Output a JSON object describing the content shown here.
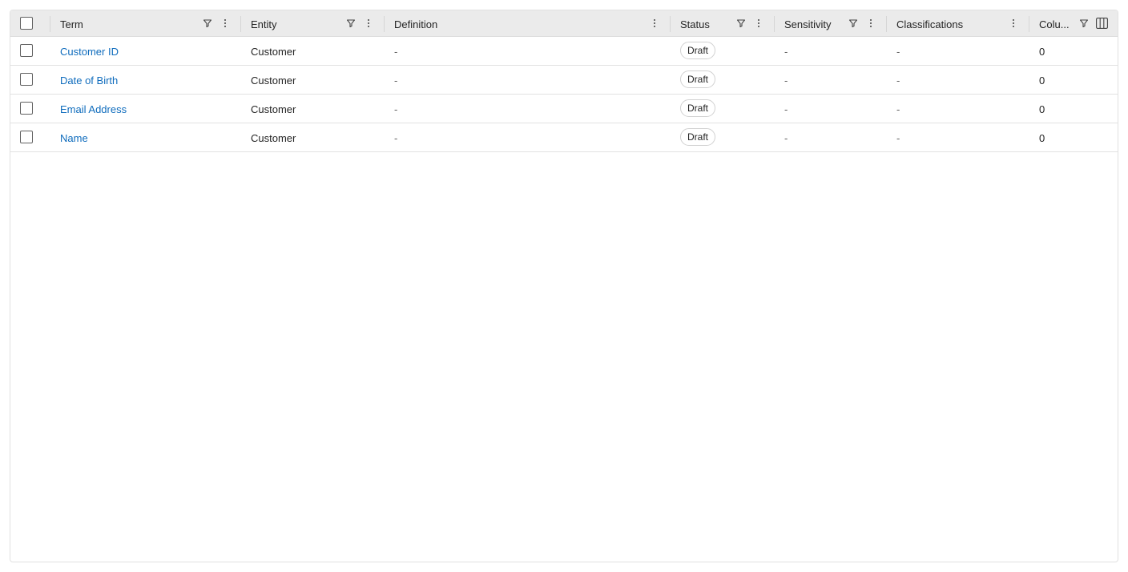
{
  "columns": {
    "term": "Term",
    "entity": "Entity",
    "definition": "Definition",
    "status": "Status",
    "sensitivity": "Sensitivity",
    "classifications": "Classifications",
    "columns_count": "Colu..."
  },
  "rows": [
    {
      "term": "Customer ID",
      "entity": "Customer",
      "definition": "-",
      "status": "Draft",
      "sensitivity": "-",
      "classifications": "-",
      "columns_count": "0"
    },
    {
      "term": "Date of Birth",
      "entity": "Customer",
      "definition": "-",
      "status": "Draft",
      "sensitivity": "-",
      "classifications": "-",
      "columns_count": "0"
    },
    {
      "term": "Email Address",
      "entity": "Customer",
      "definition": "-",
      "status": "Draft",
      "sensitivity": "-",
      "classifications": "-",
      "columns_count": "0"
    },
    {
      "term": "Name",
      "entity": "Customer",
      "definition": "-",
      "status": "Draft",
      "sensitivity": "-",
      "classifications": "-",
      "columns_count": "0"
    }
  ],
  "icons": {
    "filter": "filter-icon",
    "more": "more-vertical-icon",
    "column_chooser": "column-chooser-icon"
  },
  "colors": {
    "link": "#0f6cbd",
    "header_bg": "#ebebeb",
    "border": "#e1e1e1"
  }
}
